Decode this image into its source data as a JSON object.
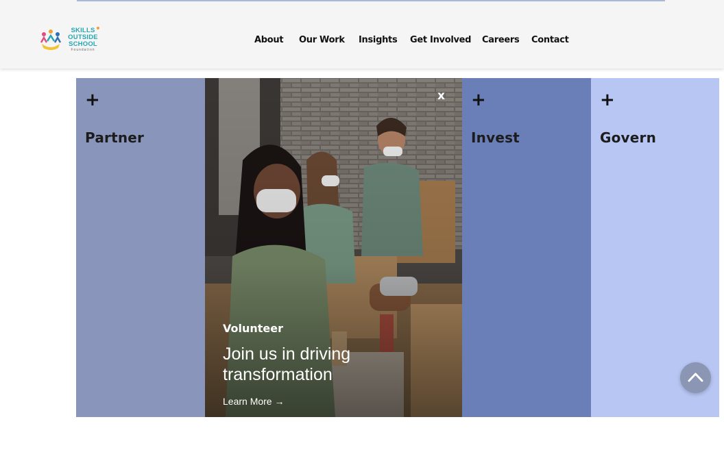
{
  "brand": {
    "logo_lines": [
      "SKILLS",
      "OUTSIDE",
      "SCHOOL",
      "Foundation"
    ],
    "accent": "#25a6b3"
  },
  "nav": {
    "items": [
      "About",
      "Our Work",
      "Insights",
      "Get Involved",
      "Careers",
      "Contact"
    ]
  },
  "panels": [
    {
      "plus": "+",
      "title": "Partner",
      "color": "#8995ba"
    },
    {
      "close": "x",
      "kicker": "Volunteer",
      "headline": "Join us in driving transformation",
      "link": "Learn More →",
      "image_alt": "Volunteers wearing face masks sorting donation boxes"
    },
    {
      "plus": "+",
      "title": "Invest",
      "color": "#6a7fb8"
    },
    {
      "plus": "+",
      "title": "Govern",
      "color": "#b7c6f2"
    }
  ],
  "icons": {
    "scroll_top": "chevron-up-icon"
  }
}
